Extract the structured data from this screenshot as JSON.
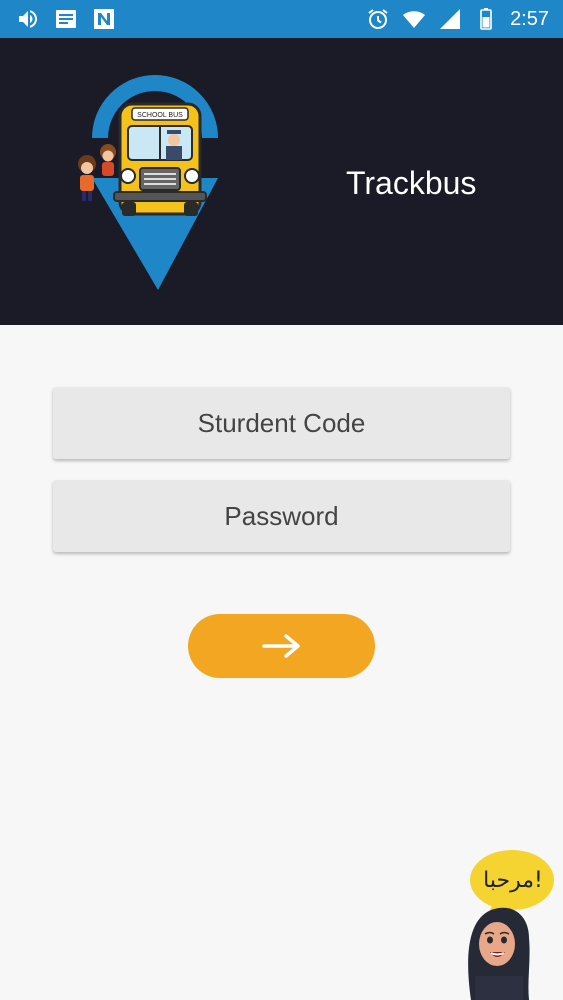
{
  "status_bar": {
    "time": "2:57",
    "left_icons": [
      "volume-icon",
      "message-icon",
      "n-icon"
    ],
    "right_icons": [
      "alarm-icon",
      "wifi-icon",
      "signal-icon",
      "battery-icon"
    ],
    "color": "#1f86c8"
  },
  "header": {
    "app_name": "Trackbus",
    "logo_text": "SCHOOL BUS",
    "background": "#1a1b26"
  },
  "form": {
    "student_code_placeholder": "Sturdent Code",
    "password_placeholder": "Password",
    "submit_icon": "arrow-right-icon",
    "submit_color": "#f2a622"
  },
  "mascot": {
    "greeting": "مرحبا!"
  }
}
